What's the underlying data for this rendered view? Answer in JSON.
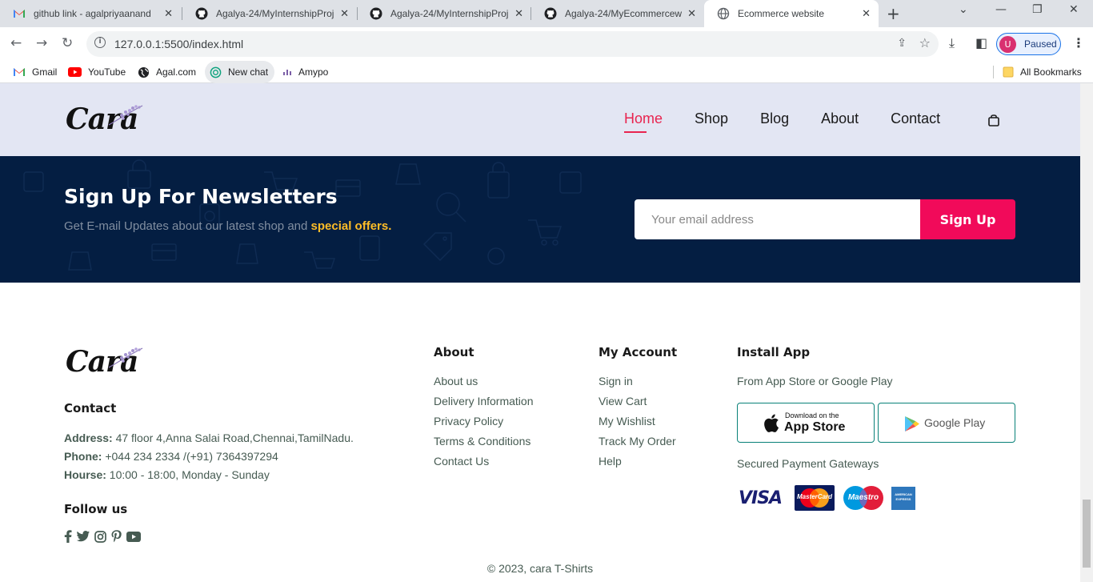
{
  "browser": {
    "tabs": [
      {
        "title": "github link - agalpriyaanand",
        "icon": "gmail-icon",
        "active": false
      },
      {
        "title": "Agalya-24/MyInternshipProj",
        "icon": "github-icon",
        "active": false
      },
      {
        "title": "Agalya-24/MyInternshipProj",
        "icon": "github-icon",
        "active": false
      },
      {
        "title": "Agalya-24/MyEcommercew",
        "icon": "github-icon",
        "active": false
      },
      {
        "title": "Ecommerce website",
        "icon": "globe-icon",
        "active": true
      }
    ],
    "url": "127.0.0.1:5500/index.html",
    "profile_initial": "U",
    "profile_status": "Paused",
    "bookmarks": [
      {
        "label": "Gmail",
        "icon": "gmail-icon"
      },
      {
        "label": "YouTube",
        "icon": "youtube-icon"
      },
      {
        "label": "Agal.com",
        "icon": "globe-icon"
      },
      {
        "label": "New chat",
        "icon": "chatgpt-icon"
      },
      {
        "label": "Amypo",
        "icon": "amypo-icon"
      }
    ],
    "all_bookmarks": "All Bookmarks"
  },
  "site": {
    "logo": "Cara",
    "nav": [
      "Home",
      "Shop",
      "Blog",
      "About",
      "Contact"
    ],
    "active_nav": "Home",
    "accent_color": "#e8244f"
  },
  "newsletter": {
    "title": "Sign Up For Newsletters",
    "subtitle_prefix": "Get E-mail Updates about our latest shop and",
    "subtitle_highlight": "special offers.",
    "email_placeholder": "Your email address",
    "button_label": "Sign Up",
    "bg_color": "#041e42",
    "button_color": "#f10a5a",
    "highlight_color": "#ffbd27"
  },
  "footer": {
    "logo": "Cara",
    "contact_heading": "Contact",
    "address_label": "Address:",
    "address_value": "47 floor 4,Anna Salai Road,Chennai,TamilNadu.",
    "phone_label": "Phone:",
    "phone_value": "+044 234 2334 /(+91) 7364397294",
    "hours_label": "Hourse:",
    "hours_value": "10:00 - 18:00, Monday - Sunday",
    "follow_heading": "Follow us",
    "social": [
      "facebook-icon",
      "twitter-icon",
      "instagram-icon",
      "pinterest-icon",
      "youtube-icon"
    ],
    "about_heading": "About",
    "about_links": [
      "About us",
      "Delivery Information",
      "Privacy Policy",
      "Terms & Conditions",
      "Contact Us"
    ],
    "account_heading": "My Account",
    "account_links": [
      "Sign in",
      "View Cart",
      "My Wishlist",
      "Track My Order",
      "Help"
    ],
    "install_heading": "Install App",
    "install_sub": "From App Store or Google Play",
    "appstore_small": "Download on the",
    "appstore_big": "App Store",
    "googleplay": "Google Play",
    "payment_heading": "Secured Payment Gateways",
    "payment_methods": [
      "VISA",
      "MasterCard",
      "Maestro",
      "AMERICAN EXPRESS"
    ],
    "copyright": "© 2023, cara T-Shirts"
  }
}
